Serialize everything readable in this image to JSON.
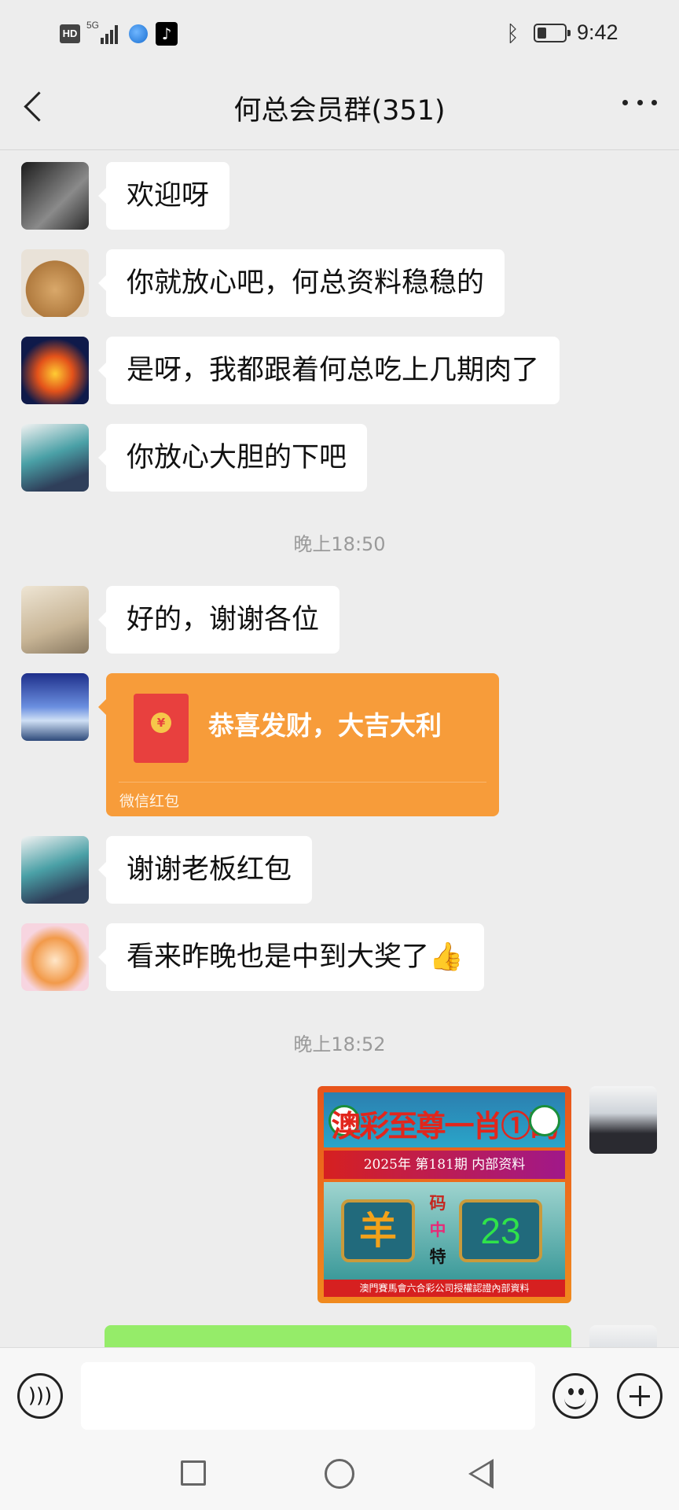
{
  "status_bar": {
    "hd": "HD",
    "network": "5G",
    "time": "9:42",
    "battery_level": 0.35
  },
  "header": {
    "title": "何总会员群(351)"
  },
  "messages": [
    {
      "text": "欢迎呀"
    },
    {
      "text": "你就放心吧，何总资料稳稳的"
    },
    {
      "text": "是呀，我都跟着何总吃上几期肉了"
    },
    {
      "text": "你放心大胆的下吧"
    },
    {
      "text": "好的，谢谢各位"
    },
    {
      "text": "谢谢老板红包"
    },
    {
      "text": "看来昨晚也是中到大奖了👍"
    }
  ],
  "timestamps": [
    "晚上18:50",
    "晚上18:52"
  ],
  "red_packet": {
    "title": "恭喜发财，大吉大利",
    "label": "微信红包",
    "coin": "¥"
  },
  "lottery_image": {
    "headline": "澳彩至尊一肖①码",
    "band": "2025年 第181期 内部资料",
    "zodiac": "羊",
    "middle": [
      "码",
      "中",
      "特"
    ],
    "number": "23",
    "footer": "澳門賽馬會六合彩公司授權認證內部資料"
  },
  "colors": {
    "background": "#ededed",
    "bubble": "#ffffff",
    "red_packet": "#f79c3a",
    "sent_bubble": "#95ec69"
  },
  "icons": {
    "back": "chevron-left-icon",
    "more": "more-dots-icon",
    "voice": "voice-icon",
    "emoji": "emoji-icon",
    "plus": "plus-icon"
  }
}
